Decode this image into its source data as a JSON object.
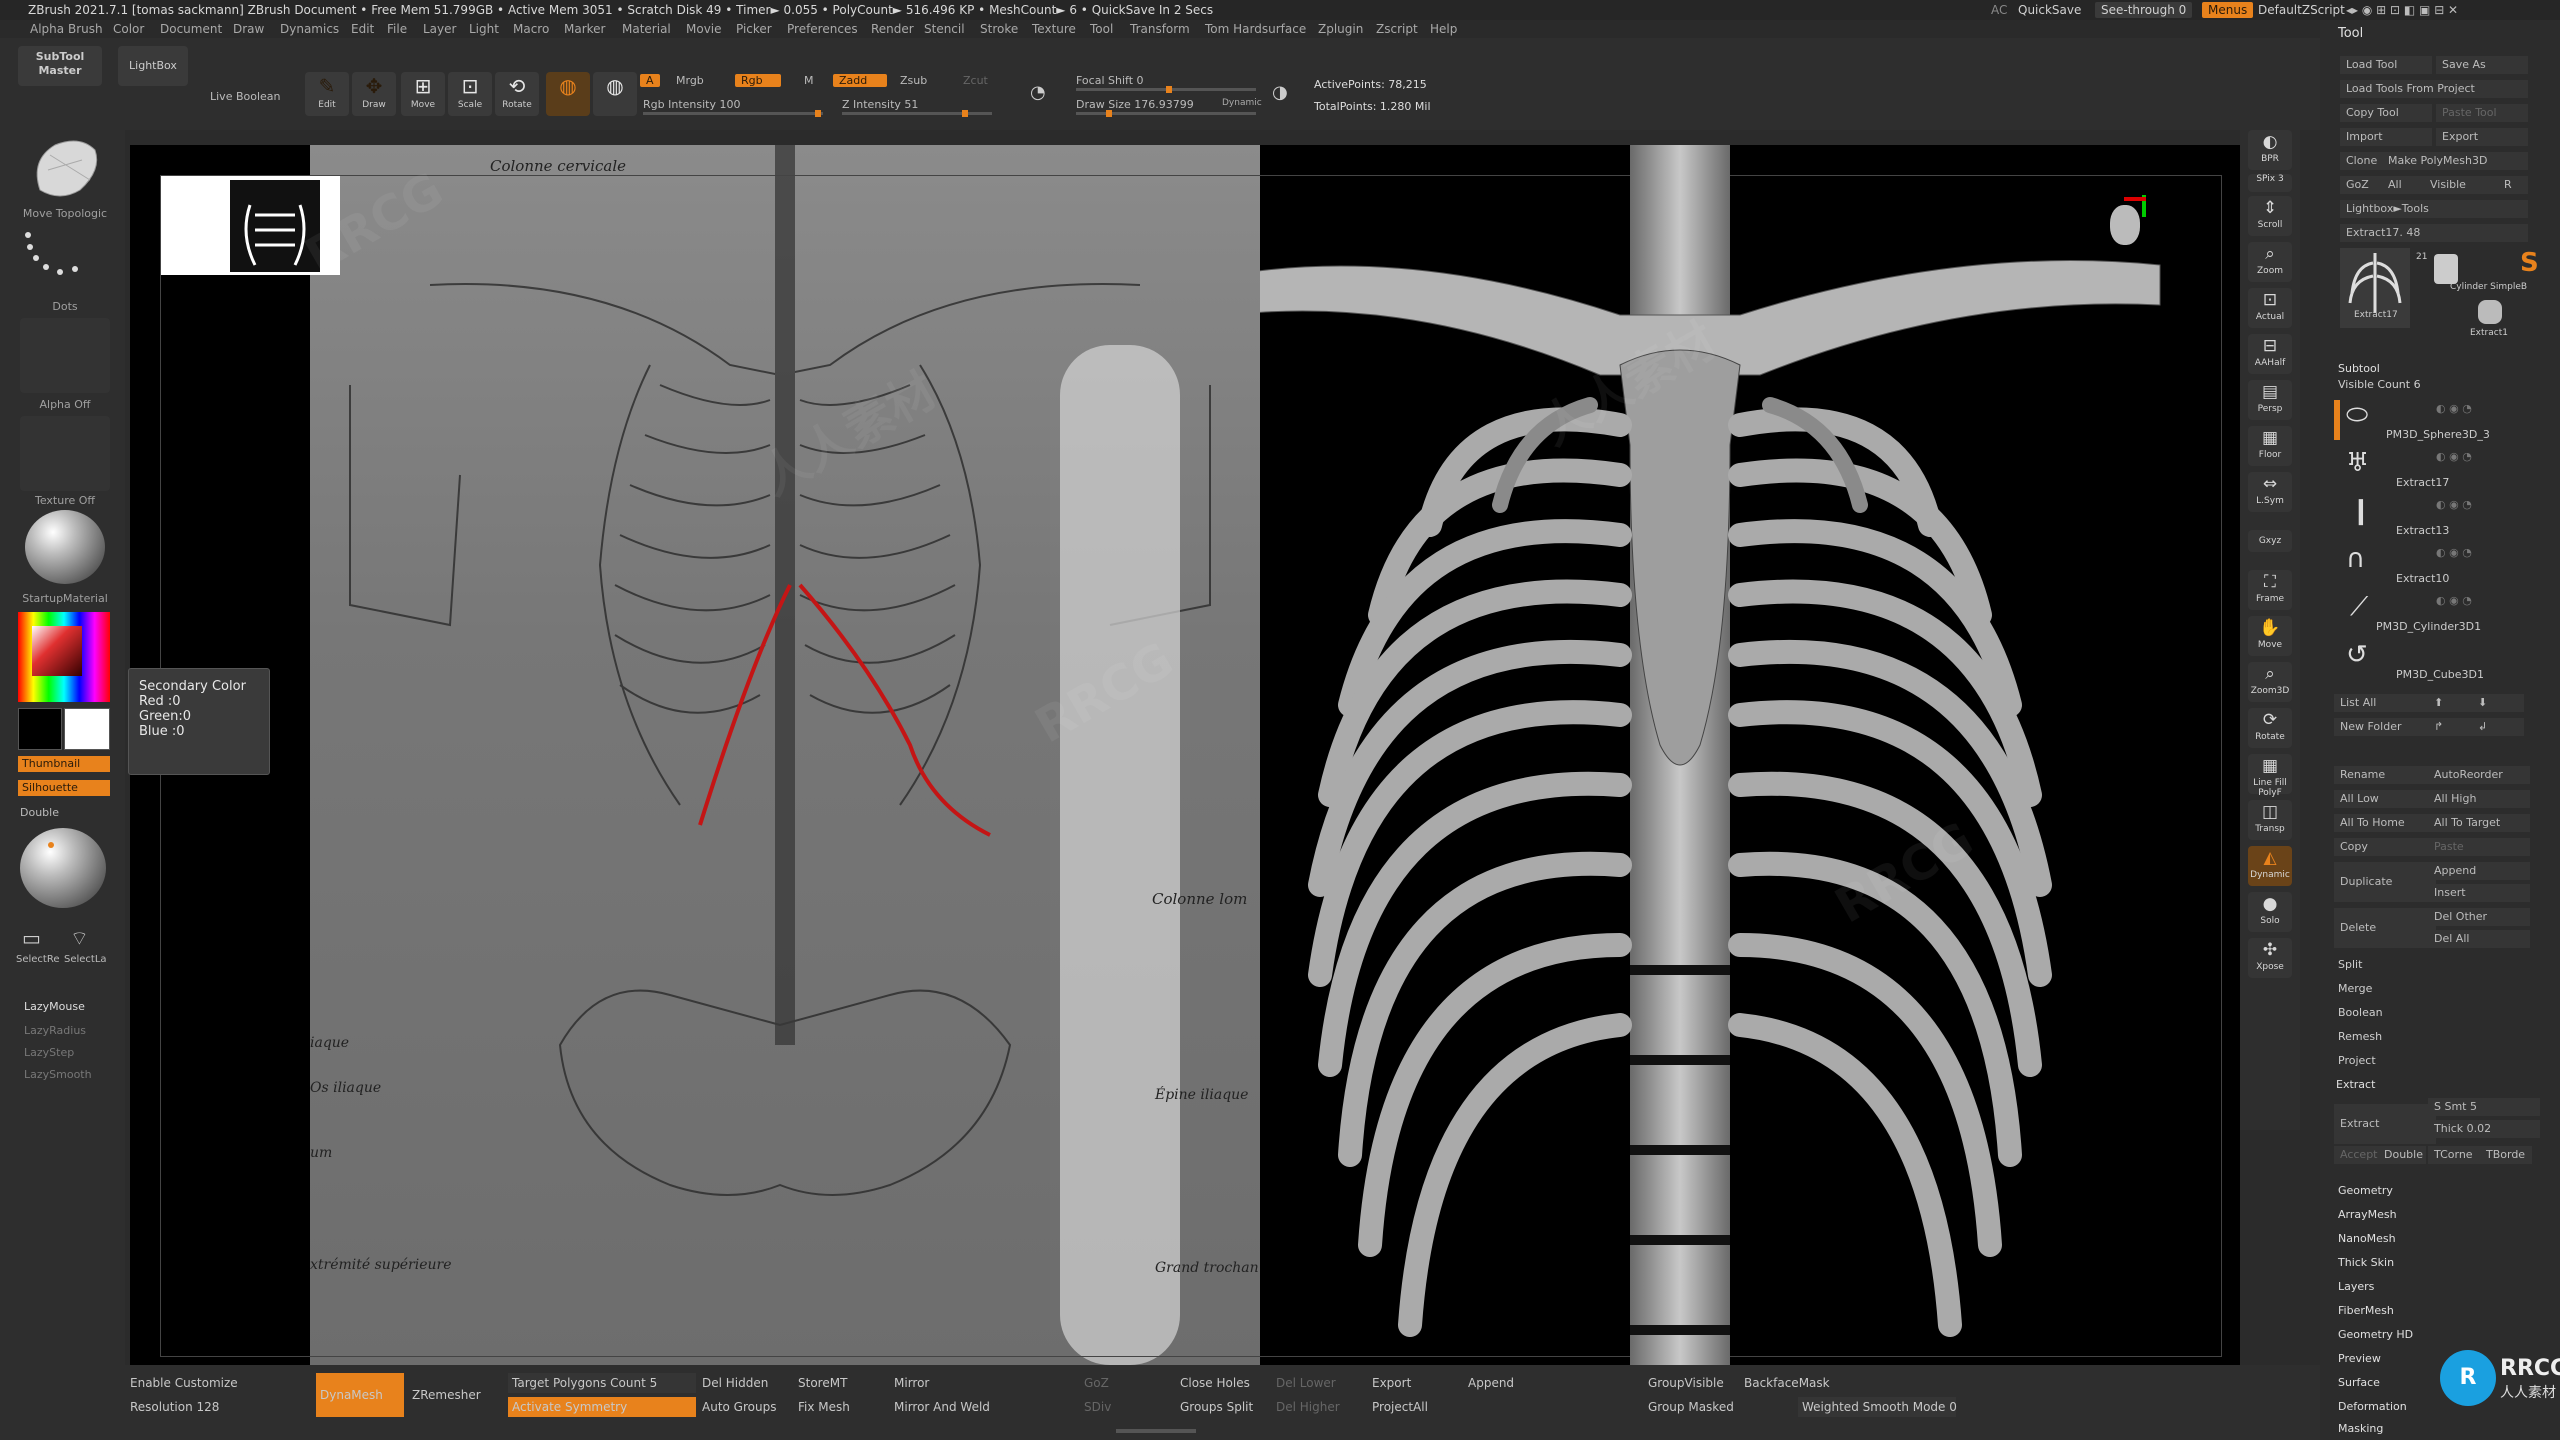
{
  "titlebar": {
    "title": "ZBrush 2021.7.1 [tomas sackmann]   ZBrush Document     • Free Mem 51.799GB • Active Mem 3051 • Scratch Disk 49 • Timer► 0.055 • PolyCount► 516.496 KP • MeshCount► 6 • QuickSave In 2 Secs",
    "ac": "AC",
    "quicksave": "QuickSave",
    "see_through": "See-through  0",
    "menus": "Menus",
    "default_zscript": "DefaultZScript"
  },
  "menubar": [
    "Alpha",
    "Brush",
    "Color",
    "Document",
    "Draw",
    "Dynamics",
    "Edit",
    "File",
    "Layer",
    "Light",
    "Macro",
    "Marker",
    "Material",
    "Movie",
    "Picker",
    "Preferences",
    "Render",
    "Stencil",
    "Stroke",
    "Texture",
    "Tool",
    "Transform",
    "Tom Hardsurface",
    "Zplugin",
    "Zscript",
    "Help"
  ],
  "topshelf": {
    "subtool_master": "SubTool Master",
    "lightbox": "LightBox",
    "live_boolean": "Live Boolean",
    "edit": "Edit",
    "draw": "Draw",
    "move": "Move",
    "scale": "Scale",
    "rotate": "Rotate",
    "a": "A",
    "mrgb": "Mrgb",
    "rgb": "Rgb",
    "m": "M",
    "zadd": "Zadd",
    "zsub": "Zsub",
    "zcut": "Zcut",
    "rgb_intensity": "Rgb Intensity 100",
    "z_intensity": "Z Intensity 51",
    "focal_shift": "Focal Shift 0",
    "draw_size": "Draw Size 176.93799",
    "dynamic": "Dynamic",
    "active_points": "ActivePoints: 78,215",
    "total_points": "TotalPoints: 1.280 Mil"
  },
  "leftpanel": {
    "brush": "Move Topologic",
    "stroke": "Dots",
    "alpha": "Alpha Off",
    "texture": "Texture Off",
    "material": "StartupMaterial",
    "thumbnail": "Thumbnail",
    "silhouette": "Silhouette",
    "double": "Double",
    "selectrx": "SelectRe",
    "selectlx": "SelectLa",
    "lazymouse": "LazyMouse",
    "lazyradius": "LazyRadius",
    "lazystep": "LazyStep",
    "lazysmooth": "LazySmooth"
  },
  "tooltip": {
    "title": "Secondary Color",
    "red": "Red :0",
    "green": "Green:0",
    "blue": "Blue :0"
  },
  "reference_text": {
    "cervical": "Colonne cervicale",
    "lombaire": "Colonne lom",
    "iliaque": "iaque",
    "os_iliaque": "Os iliaque",
    "epine": "Épine iliaque",
    "um": "um",
    "extremite": "xtrémité supérieure",
    "grand_trochan": "Grand trochan"
  },
  "rightshelf": [
    "BPR",
    "SPix 3",
    "Scroll",
    "Zoom",
    "Actual",
    "AAHalf",
    "Persp",
    "Floor",
    "L.Sym",
    "Gxyz",
    "Frame",
    "Move",
    "Zoom3D",
    "Rotate",
    "Line Fill PolyF",
    "Transp",
    "Dynamic",
    "Solo",
    "Xpose"
  ],
  "rightpanel": {
    "header": "Tool",
    "load_tool": "Load Tool",
    "save_as": "Save As",
    "load_tools_project": "Load Tools From Project",
    "copy_tool": "Copy Tool",
    "paste_tool": "Paste Tool",
    "import": "Import",
    "export": "Export",
    "clone": "Clone",
    "make_polymesh": "Make PolyMesh3D",
    "goz": "GoZ",
    "all": "All",
    "visible": "Visible",
    "r": "R",
    "lightbox_tools": "Lightbox►Tools",
    "extract_slider": "Extract17. 48",
    "thumb_a": "Extract17",
    "thumb_b": "Cylinder SimpleB",
    "thumb_c": "Extract1",
    "thumb_count": "21",
    "subtool": "Subtool",
    "visible_count": "Visible Count 6",
    "subtools": [
      "PM3D_Sphere3D_3",
      "Extract17",
      "Extract13",
      "Extract10",
      "PM3D_Cylinder3D1",
      "PM3D_Cube3D1"
    ],
    "list_all": "List All",
    "new_folder": "New Folder",
    "rename": "Rename",
    "autoreorder": "AutoReorder",
    "all_low": "All Low",
    "all_high": "All High",
    "all_to_home": "All To Home",
    "all_to_target": "All To Target",
    "copy": "Copy",
    "paste": "Paste",
    "duplicate": "Duplicate",
    "append": "Append",
    "insert": "Insert",
    "delete": "Delete",
    "del_other": "Del Other",
    "del_all": "Del All",
    "split": "Split",
    "merge": "Merge",
    "boolean": "Boolean",
    "remesh": "Remesh",
    "project": "Project",
    "extract_hdr": "Extract",
    "extract": "Extract",
    "s_smt": "S Smt 5",
    "thick": "Thick 0.02",
    "accept": "Accept",
    "double": "Double",
    "tcorne": "TCorne",
    "tborde": "TBorde",
    "sections": [
      "Geometry",
      "ArrayMesh",
      "NanoMesh",
      "Thick Skin",
      "Layers",
      "FiberMesh",
      "Geometry HD",
      "Preview",
      "Surface",
      "Deformation",
      "Masking"
    ]
  },
  "bottomshelf": {
    "enable_customize": "Enable Customize",
    "resolution": "Resolution 128",
    "dynamesh": "DynaMesh",
    "zremesher": "ZRemesher",
    "target_polys": "Target Polygons Count 5",
    "activate_symmetry": "Activate Symmetry",
    "del_hidden": "Del Hidden",
    "auto_groups": "Auto Groups",
    "storemt": "StoreMT",
    "fix_mesh": "Fix Mesh",
    "mirror": "Mirror",
    "mirror_weld": "Mirror And Weld",
    "gizmo": "GoZ",
    "sdiv": "SDiv",
    "close_holes": "Close Holes",
    "groups_split": "Groups Split",
    "del_lower": "Del Lower",
    "del_higher": "Del Higher",
    "export": "Export",
    "projectall": "ProjectAll",
    "append": "Append",
    "groupvisible": "GroupVisible",
    "group_masked": "Group Masked",
    "backfacemask": "BackfaceMask",
    "weighted_smooth": "Weighted Smooth Mode 0"
  },
  "watermark": {
    "rrcg": "RRCG",
    "cn": "人人素材",
    "logo_cn": "人人素材"
  },
  "colors": {
    "accent": "#e8821c",
    "bg": "#2b2b2b",
    "canvas": "#000000"
  }
}
